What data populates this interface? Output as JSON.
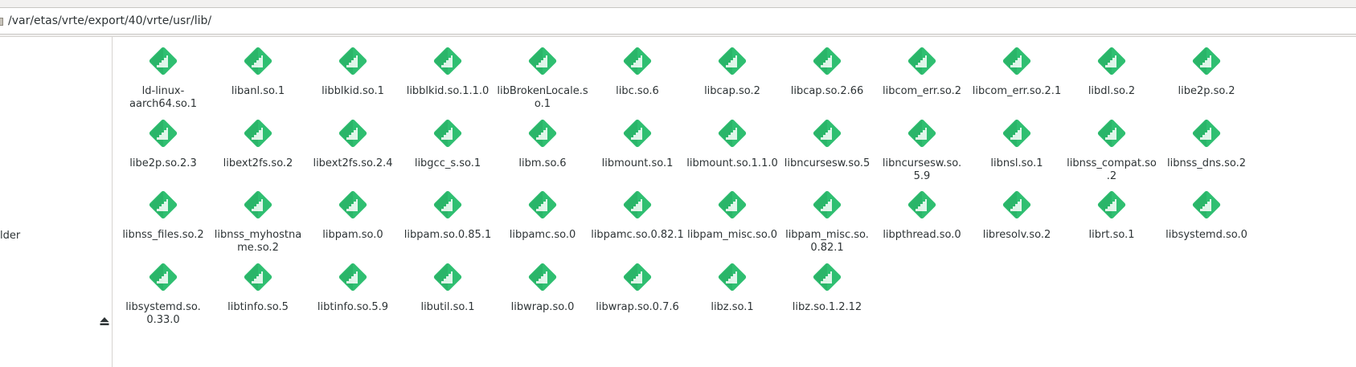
{
  "location": {
    "path": "/var/etas/vrte/export/40/vrte/usr/lib/"
  },
  "sidebar": {
    "partial_label": "lder"
  },
  "icons": {
    "file_icon": "shared-library-icon",
    "file_icon_color": "#2fbf71",
    "file_icon_dark": "#23a25d"
  },
  "files": [
    {
      "label": "ld-linux-\naarch64.so.1"
    },
    {
      "label": "libanl.so.1"
    },
    {
      "label": "libblkid.so.1"
    },
    {
      "label": "libblkid.so.1.1.0"
    },
    {
      "label": "libBrokenLocale.s\no.1"
    },
    {
      "label": "libc.so.6"
    },
    {
      "label": "libcap.so.2"
    },
    {
      "label": "libcap.so.2.66"
    },
    {
      "label": "libcom_err.so.2"
    },
    {
      "label": "libcom_err.so.2.1"
    },
    {
      "label": "libdl.so.2"
    },
    {
      "label": "libe2p.so.2"
    },
    {
      "label": "libe2p.so.2.3"
    },
    {
      "label": "libext2fs.so.2"
    },
    {
      "label": "libext2fs.so.2.4"
    },
    {
      "label": "libgcc_s.so.1"
    },
    {
      "label": "libm.so.6"
    },
    {
      "label": "libmount.so.1"
    },
    {
      "label": "libmount.so.1.1.0"
    },
    {
      "label": "libncursesw.so.5"
    },
    {
      "label": "libncursesw.so.\n5.9"
    },
    {
      "label": "libnsl.so.1"
    },
    {
      "label": "libnss_compat.so\n.2"
    },
    {
      "label": "libnss_dns.so.2"
    },
    {
      "label": "libnss_files.so.2"
    },
    {
      "label": "libnss_myhostna\nme.so.2"
    },
    {
      "label": "libpam.so.0"
    },
    {
      "label": "libpam.so.0.85.1"
    },
    {
      "label": "libpamc.so.0"
    },
    {
      "label": "libpamc.so.0.82.1"
    },
    {
      "label": "libpam_misc.so.0"
    },
    {
      "label": "libpam_misc.so.\n0.82.1"
    },
    {
      "label": "libpthread.so.0"
    },
    {
      "label": "libresolv.so.2"
    },
    {
      "label": "librt.so.1"
    },
    {
      "label": "libsystemd.so.0"
    },
    {
      "label": "libsystemd.so.\n0.33.0"
    },
    {
      "label": "libtinfo.so.5"
    },
    {
      "label": "libtinfo.so.5.9"
    },
    {
      "label": "libutil.so.1"
    },
    {
      "label": "libwrap.so.0"
    },
    {
      "label": "libwrap.so.0.7.6"
    },
    {
      "label": "libz.so.1"
    },
    {
      "label": "libz.so.1.2.12"
    }
  ]
}
